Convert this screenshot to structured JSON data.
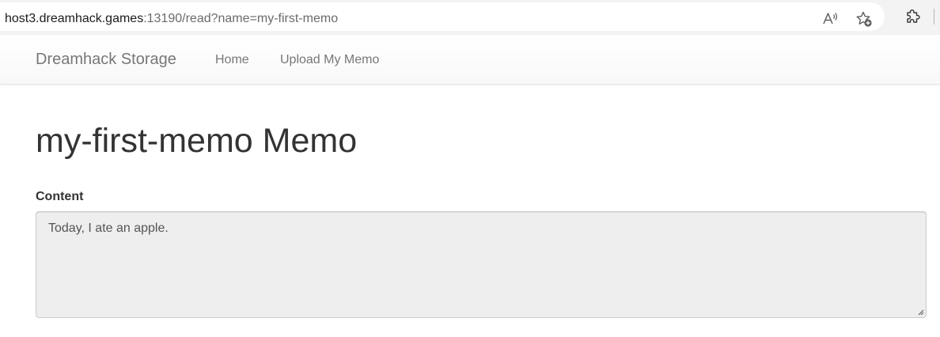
{
  "browser": {
    "url_host": "host3.dreamhack.games",
    "url_rest": ":13190/read?name=my-first-memo",
    "icons": [
      "read-aloud-icon",
      "add-favorite-icon",
      "extensions-icon"
    ]
  },
  "navbar": {
    "brand": "Dreamhack Storage",
    "links": [
      {
        "label": "Home"
      },
      {
        "label": "Upload My Memo"
      }
    ]
  },
  "page": {
    "title": "my-first-memo Memo",
    "content_label": "Content",
    "content_value": "Today, I ate an apple."
  },
  "colors": {
    "link": "#777777",
    "heading": "#333333",
    "readonly_bg": "#eeeeee"
  }
}
